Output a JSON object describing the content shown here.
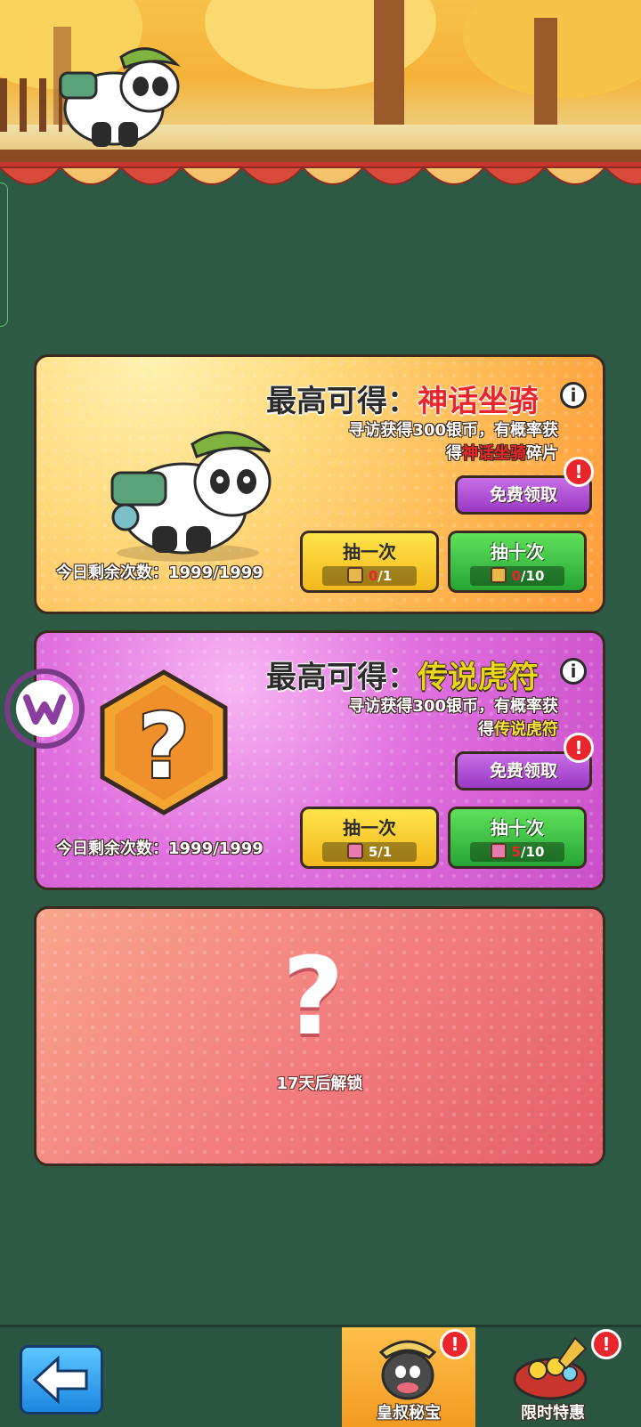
{
  "cards": [
    {
      "title_prefix": "最高可得：",
      "title_highlight": "神话坐骑",
      "highlight_color": "#e8262c",
      "desc_line1": "寻访获得300银币，有概率获",
      "desc_line2_pre": "得",
      "desc_line2_hl": "神话坐骑",
      "desc_line2_post": "碎片",
      "free_label": "免费领取",
      "draw_one_label": "抽一次",
      "draw_one_cost_have": "0",
      "draw_one_cost_need": "/1",
      "draw_ten_label": "抽十次",
      "draw_ten_cost_have": "0",
      "draw_ten_cost_need": "/10",
      "remaining_label": "今日剩余次数：",
      "remaining_value": "1999/1999",
      "reward_icon": "panda-mount-icon"
    },
    {
      "title_prefix": "最高可得：",
      "title_highlight": "传说虎符",
      "highlight_color": "#e9d617",
      "desc_line1": "寻访获得300银币，有概率获",
      "desc_line2_pre": "得",
      "desc_line2_hl": "传说虎符",
      "desc_line2_post": "",
      "free_label": "免费领取",
      "draw_one_label": "抽一次",
      "draw_one_cost": "5/1",
      "draw_ten_label": "抽十次",
      "draw_ten_cost_have": "5",
      "draw_ten_cost_need": "/10",
      "remaining_label": "今日剩余次数：",
      "remaining_value": "1999/1999",
      "reward_icon": "mystery-hexagon-icon"
    },
    {
      "locked_symbol": "?",
      "unlock_text": "17天后解锁"
    }
  ],
  "badge_symbol": "!",
  "bottom_bar": {
    "tab1_label": "皇叔秘宝",
    "tab2_label": "限时特惠"
  }
}
